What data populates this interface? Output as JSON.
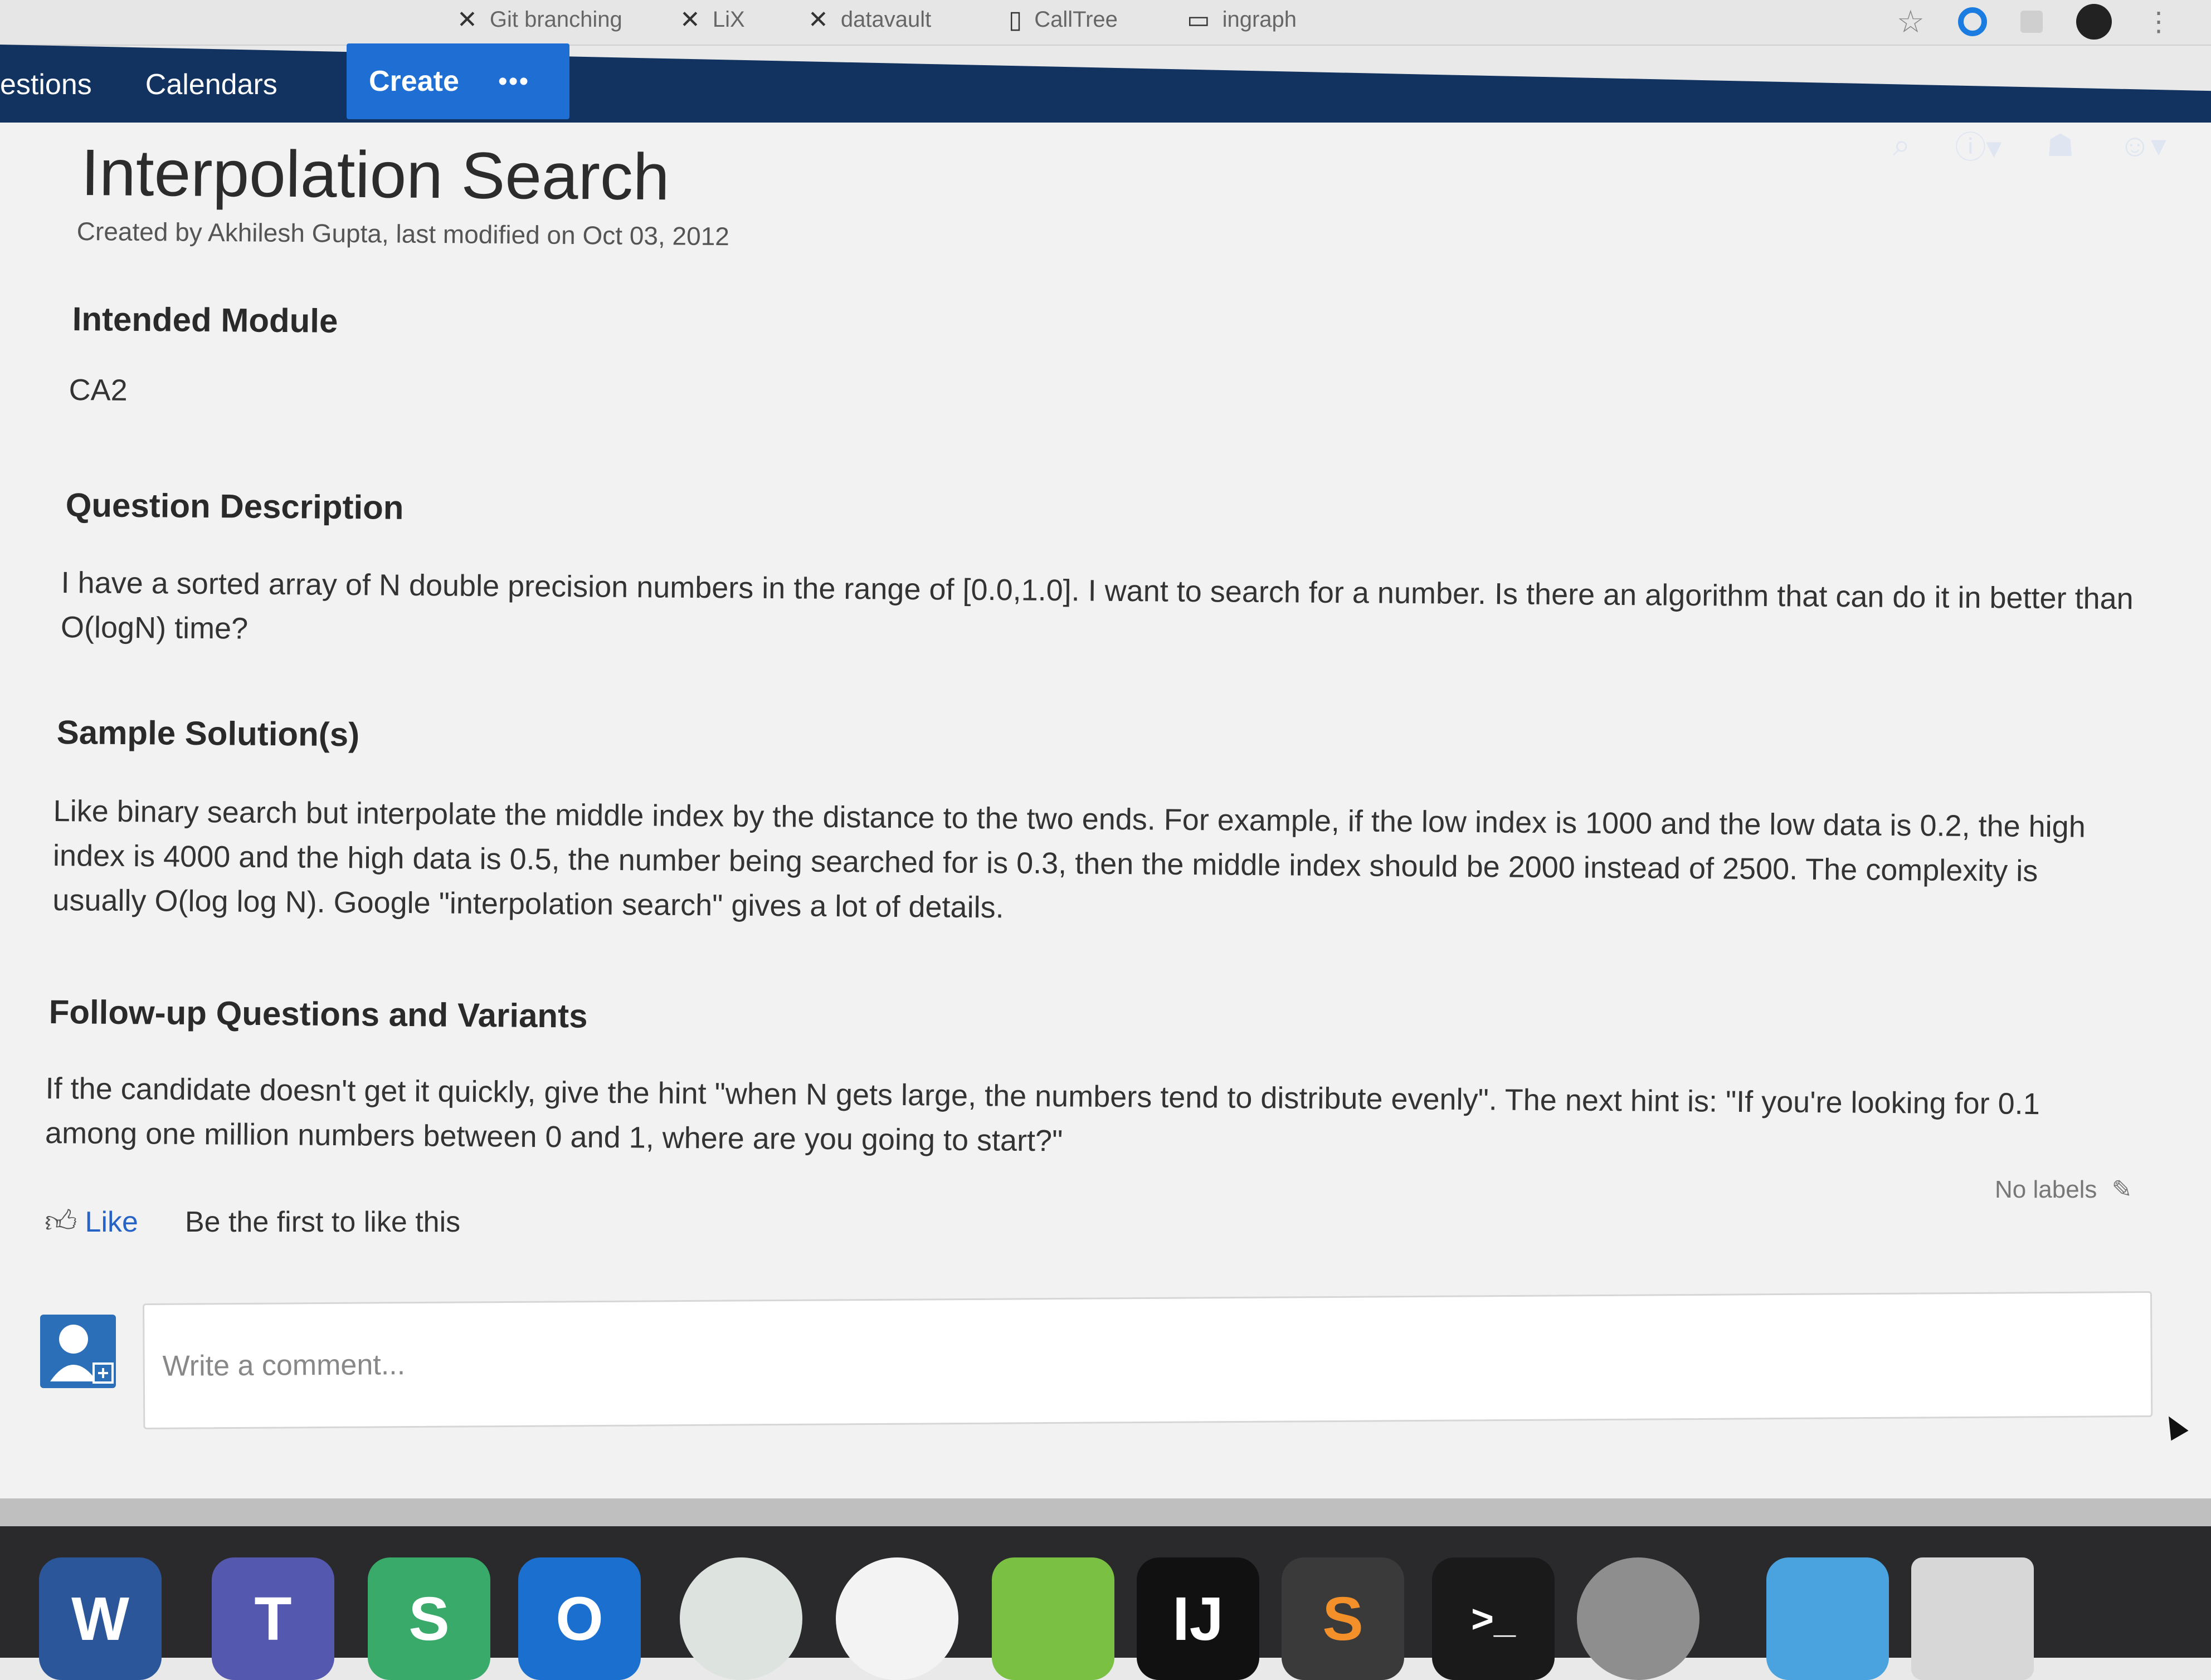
{
  "bookmarks": [
    {
      "label": "Git branching",
      "icon": "git-icon"
    },
    {
      "label": "LiX",
      "icon": "linkedin-x-icon"
    },
    {
      "label": "datavault",
      "icon": "linkedin-x-icon"
    },
    {
      "label": "CallTree",
      "icon": "document-icon"
    },
    {
      "label": "ingraph",
      "icon": "folder-icon"
    }
  ],
  "nav": {
    "items": [
      "estions",
      "Calendars"
    ],
    "create_label": "Create",
    "more_label": "•••"
  },
  "page": {
    "title": "Interpolation Search",
    "byline": "Created by Akhilesh Gupta, last modified on Oct 03, 2012"
  },
  "sections": [
    {
      "heading": "Intended Module",
      "body": "CA2"
    },
    {
      "heading": "Question Description",
      "body": "I have a sorted array of N double precision numbers in the range of [0.0,1.0]. I want to search for a number. Is there an algorithm that can do it in better than O(logN) time?"
    },
    {
      "heading": "Sample Solution(s)",
      "body": "Like binary search but interpolate the middle index by the distance to the two ends. For example, if the low index is 1000 and the low data is 0.2, the high index is 4000 and the high data is 0.5, the number being searched for is 0.3, then the middle index should be 2000 instead of 2500. The complexity is usually O(log log N). Google \"interpolation search\" gives a lot of details."
    },
    {
      "heading": "Follow-up Questions and Variants",
      "body": "If the candidate doesn't get it quickly, give the hint \"when N gets large, the numbers tend to distribute evenly\". The next hint is: \"If you're looking for 0.1 among one million numbers between 0 and 1, where are you going to start?\""
    }
  ],
  "footer": {
    "like_label": "Like",
    "like_text": "Be the first to like this",
    "labels_text": "No labels"
  },
  "comment": {
    "placeholder": "Write a comment..."
  },
  "dock": {
    "apps": [
      {
        "name": "Word",
        "glyph": "W"
      },
      {
        "name": "Teams",
        "glyph": "T"
      },
      {
        "name": "Slack",
        "glyph": "S"
      },
      {
        "name": "Outlook",
        "glyph": "O"
      },
      {
        "name": "IntelliJ IDEA",
        "glyph": "IJ"
      },
      {
        "name": "Terminal",
        "glyph": ">_"
      }
    ]
  },
  "colors": {
    "nav_bg": "#12325f",
    "create_bg": "#1f6ed4",
    "link": "#2563c6"
  }
}
